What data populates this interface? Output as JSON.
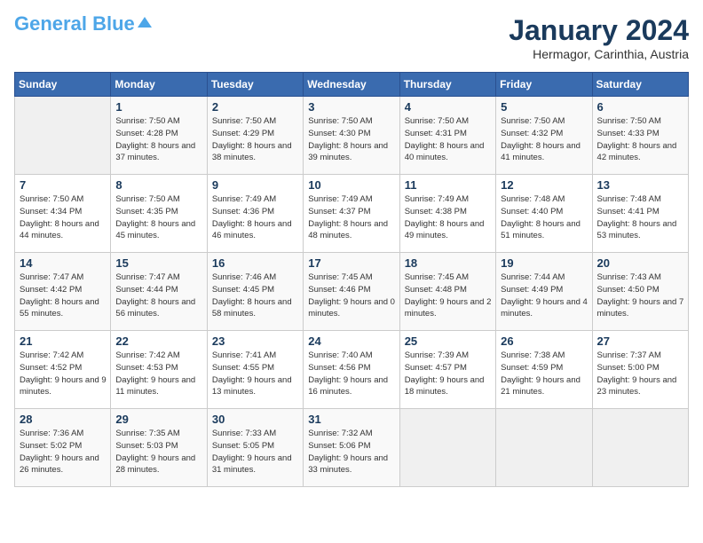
{
  "header": {
    "logo_general": "General",
    "logo_blue": "Blue",
    "month_title": "January 2024",
    "location": "Hermagor, Carinthia, Austria"
  },
  "weekdays": [
    "Sunday",
    "Monday",
    "Tuesday",
    "Wednesday",
    "Thursday",
    "Friday",
    "Saturday"
  ],
  "weeks": [
    [
      {
        "day": "",
        "sunrise": "",
        "sunset": "",
        "daylight": ""
      },
      {
        "day": "1",
        "sunrise": "Sunrise: 7:50 AM",
        "sunset": "Sunset: 4:28 PM",
        "daylight": "Daylight: 8 hours and 37 minutes."
      },
      {
        "day": "2",
        "sunrise": "Sunrise: 7:50 AM",
        "sunset": "Sunset: 4:29 PM",
        "daylight": "Daylight: 8 hours and 38 minutes."
      },
      {
        "day": "3",
        "sunrise": "Sunrise: 7:50 AM",
        "sunset": "Sunset: 4:30 PM",
        "daylight": "Daylight: 8 hours and 39 minutes."
      },
      {
        "day": "4",
        "sunrise": "Sunrise: 7:50 AM",
        "sunset": "Sunset: 4:31 PM",
        "daylight": "Daylight: 8 hours and 40 minutes."
      },
      {
        "day": "5",
        "sunrise": "Sunrise: 7:50 AM",
        "sunset": "Sunset: 4:32 PM",
        "daylight": "Daylight: 8 hours and 41 minutes."
      },
      {
        "day": "6",
        "sunrise": "Sunrise: 7:50 AM",
        "sunset": "Sunset: 4:33 PM",
        "daylight": "Daylight: 8 hours and 42 minutes."
      }
    ],
    [
      {
        "day": "7",
        "sunrise": "Sunrise: 7:50 AM",
        "sunset": "Sunset: 4:34 PM",
        "daylight": "Daylight: 8 hours and 44 minutes."
      },
      {
        "day": "8",
        "sunrise": "Sunrise: 7:50 AM",
        "sunset": "Sunset: 4:35 PM",
        "daylight": "Daylight: 8 hours and 45 minutes."
      },
      {
        "day": "9",
        "sunrise": "Sunrise: 7:49 AM",
        "sunset": "Sunset: 4:36 PM",
        "daylight": "Daylight: 8 hours and 46 minutes."
      },
      {
        "day": "10",
        "sunrise": "Sunrise: 7:49 AM",
        "sunset": "Sunset: 4:37 PM",
        "daylight": "Daylight: 8 hours and 48 minutes."
      },
      {
        "day": "11",
        "sunrise": "Sunrise: 7:49 AM",
        "sunset": "Sunset: 4:38 PM",
        "daylight": "Daylight: 8 hours and 49 minutes."
      },
      {
        "day": "12",
        "sunrise": "Sunrise: 7:48 AM",
        "sunset": "Sunset: 4:40 PM",
        "daylight": "Daylight: 8 hours and 51 minutes."
      },
      {
        "day": "13",
        "sunrise": "Sunrise: 7:48 AM",
        "sunset": "Sunset: 4:41 PM",
        "daylight": "Daylight: 8 hours and 53 minutes."
      }
    ],
    [
      {
        "day": "14",
        "sunrise": "Sunrise: 7:47 AM",
        "sunset": "Sunset: 4:42 PM",
        "daylight": "Daylight: 8 hours and 55 minutes."
      },
      {
        "day": "15",
        "sunrise": "Sunrise: 7:47 AM",
        "sunset": "Sunset: 4:44 PM",
        "daylight": "Daylight: 8 hours and 56 minutes."
      },
      {
        "day": "16",
        "sunrise": "Sunrise: 7:46 AM",
        "sunset": "Sunset: 4:45 PM",
        "daylight": "Daylight: 8 hours and 58 minutes."
      },
      {
        "day": "17",
        "sunrise": "Sunrise: 7:45 AM",
        "sunset": "Sunset: 4:46 PM",
        "daylight": "Daylight: 9 hours and 0 minutes."
      },
      {
        "day": "18",
        "sunrise": "Sunrise: 7:45 AM",
        "sunset": "Sunset: 4:48 PM",
        "daylight": "Daylight: 9 hours and 2 minutes."
      },
      {
        "day": "19",
        "sunrise": "Sunrise: 7:44 AM",
        "sunset": "Sunset: 4:49 PM",
        "daylight": "Daylight: 9 hours and 4 minutes."
      },
      {
        "day": "20",
        "sunrise": "Sunrise: 7:43 AM",
        "sunset": "Sunset: 4:50 PM",
        "daylight": "Daylight: 9 hours and 7 minutes."
      }
    ],
    [
      {
        "day": "21",
        "sunrise": "Sunrise: 7:42 AM",
        "sunset": "Sunset: 4:52 PM",
        "daylight": "Daylight: 9 hours and 9 minutes."
      },
      {
        "day": "22",
        "sunrise": "Sunrise: 7:42 AM",
        "sunset": "Sunset: 4:53 PM",
        "daylight": "Daylight: 9 hours and 11 minutes."
      },
      {
        "day": "23",
        "sunrise": "Sunrise: 7:41 AM",
        "sunset": "Sunset: 4:55 PM",
        "daylight": "Daylight: 9 hours and 13 minutes."
      },
      {
        "day": "24",
        "sunrise": "Sunrise: 7:40 AM",
        "sunset": "Sunset: 4:56 PM",
        "daylight": "Daylight: 9 hours and 16 minutes."
      },
      {
        "day": "25",
        "sunrise": "Sunrise: 7:39 AM",
        "sunset": "Sunset: 4:57 PM",
        "daylight": "Daylight: 9 hours and 18 minutes."
      },
      {
        "day": "26",
        "sunrise": "Sunrise: 7:38 AM",
        "sunset": "Sunset: 4:59 PM",
        "daylight": "Daylight: 9 hours and 21 minutes."
      },
      {
        "day": "27",
        "sunrise": "Sunrise: 7:37 AM",
        "sunset": "Sunset: 5:00 PM",
        "daylight": "Daylight: 9 hours and 23 minutes."
      }
    ],
    [
      {
        "day": "28",
        "sunrise": "Sunrise: 7:36 AM",
        "sunset": "Sunset: 5:02 PM",
        "daylight": "Daylight: 9 hours and 26 minutes."
      },
      {
        "day": "29",
        "sunrise": "Sunrise: 7:35 AM",
        "sunset": "Sunset: 5:03 PM",
        "daylight": "Daylight: 9 hours and 28 minutes."
      },
      {
        "day": "30",
        "sunrise": "Sunrise: 7:33 AM",
        "sunset": "Sunset: 5:05 PM",
        "daylight": "Daylight: 9 hours and 31 minutes."
      },
      {
        "day": "31",
        "sunrise": "Sunrise: 7:32 AM",
        "sunset": "Sunset: 5:06 PM",
        "daylight": "Daylight: 9 hours and 33 minutes."
      },
      {
        "day": "",
        "sunrise": "",
        "sunset": "",
        "daylight": ""
      },
      {
        "day": "",
        "sunrise": "",
        "sunset": "",
        "daylight": ""
      },
      {
        "day": "",
        "sunrise": "",
        "sunset": "",
        "daylight": ""
      }
    ]
  ]
}
